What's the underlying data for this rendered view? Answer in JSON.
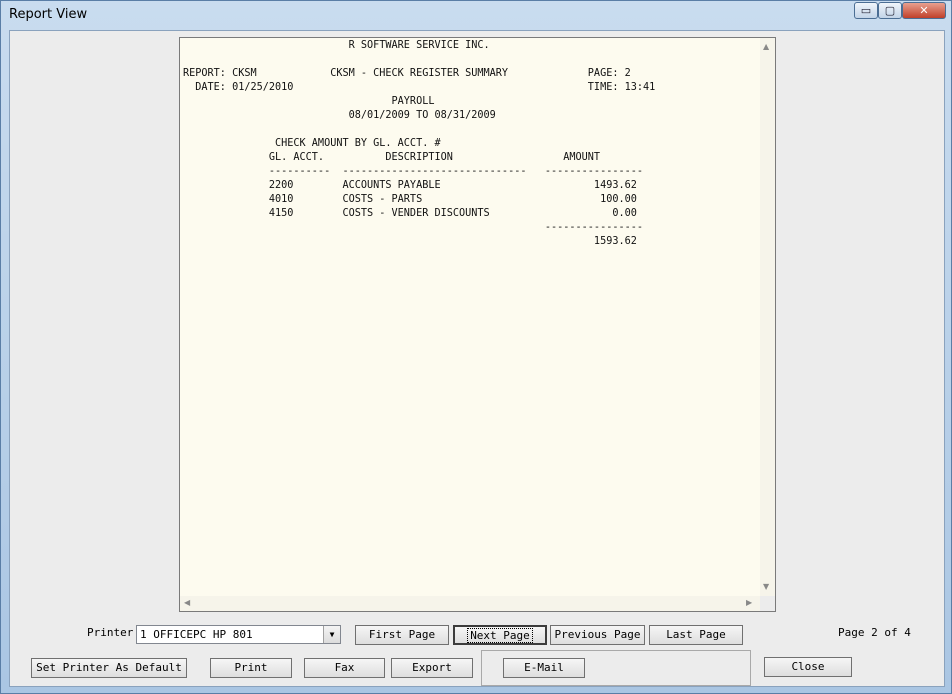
{
  "window": {
    "title": "Report View",
    "min_symbol": "▭",
    "max_symbol": "▢",
    "close_symbol": "✕"
  },
  "report": {
    "lines": [
      "                           R SOFTWARE SERVICE INC.",
      "",
      "REPORT: CKSM            CKSM - CHECK REGISTER SUMMARY             PAGE: 2",
      "  DATE: 01/25/2010                                                TIME: 13:41",
      "                                  PAYROLL",
      "                           08/01/2009 TO 08/31/2009",
      "",
      "               CHECK AMOUNT BY GL. ACCT. #",
      "              GL. ACCT.          DESCRIPTION                  AMOUNT",
      "              ----------  ------------------------------   ----------------",
      "              2200        ACCOUNTS PAYABLE                         1493.62",
      "              4010        COSTS - PARTS                             100.00",
      "              4150        COSTS - VENDER DISCOUNTS                    0.00",
      "                                                           ----------------",
      "                                                                   1593.62"
    ]
  },
  "scroll": {
    "up_icon": "▲",
    "down_icon": "▼",
    "left_icon": "◀",
    "right_icon": "▶"
  },
  "controls": {
    "printer_label": "Printer",
    "printer_value": "1   OFFICEPC HP 801",
    "dropdown_icon": "▼",
    "first_page": "First Page",
    "next_page": "Next Page",
    "previous_page": "Previous Page",
    "last_page": "Last Page",
    "page_indicator": "Page 2  of 4",
    "set_default": "Set Printer As Default",
    "print": "Print",
    "fax": "Fax",
    "export": "Export",
    "email": "E-Mail",
    "close": "Close"
  }
}
